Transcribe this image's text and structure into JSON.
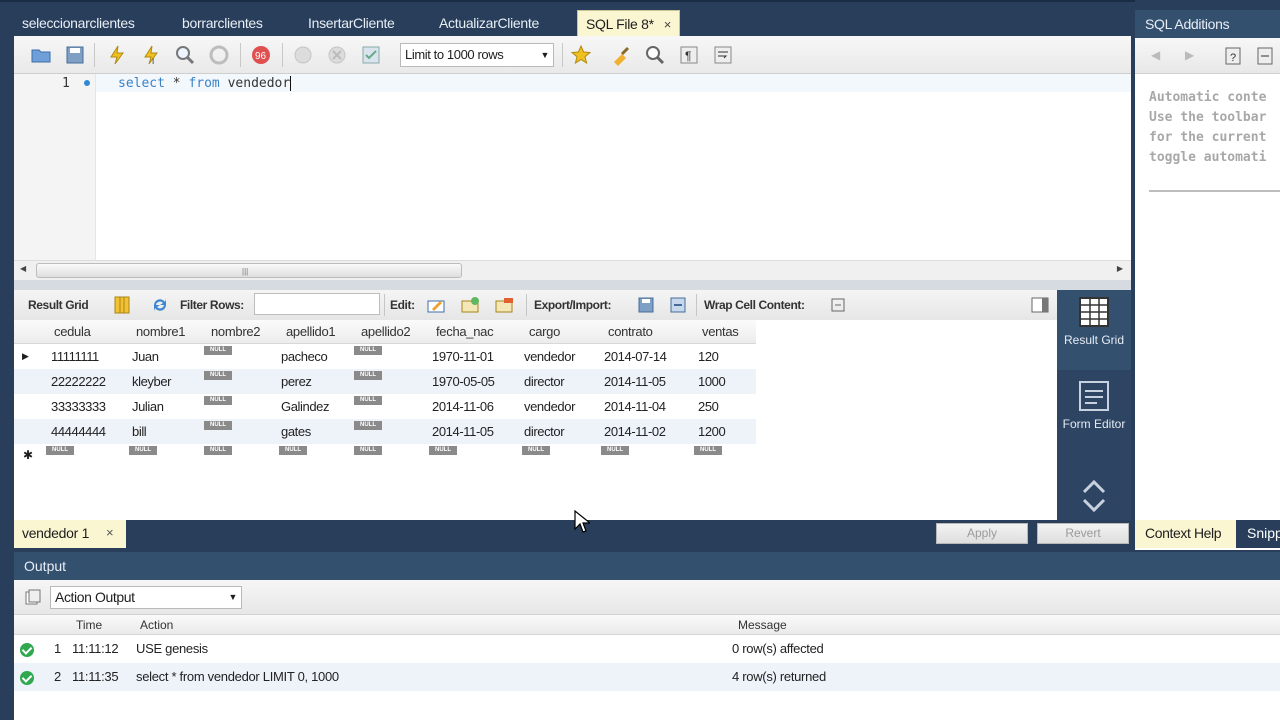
{
  "tabs": [
    {
      "label": "seleccionarclientes"
    },
    {
      "label": "borrarclientes"
    },
    {
      "label": "InsertarCliente"
    },
    {
      "label": "ActualizarCliente"
    },
    {
      "label": "SQL File 8*",
      "close": "×"
    }
  ],
  "toolbar": {
    "limit_select": "Limit to 1000 rows"
  },
  "editor": {
    "line_number": "1",
    "kw_select": "select",
    "star": " * ",
    "kw_from": "from",
    "table": " vendedor"
  },
  "result_toolbar": {
    "result_grid": "Result Grid",
    "filter_rows": "Filter Rows:",
    "edit": "Edit:",
    "export_import": "Export/Import:",
    "wrap_cell": "Wrap Cell Content:"
  },
  "grid": {
    "columns": [
      "cedula",
      "nombre1",
      "nombre2",
      "apellido1",
      "apellido2",
      "fecha_nac",
      "cargo",
      "contrato",
      "ventas"
    ],
    "null_label": "NULL",
    "rows": [
      [
        "11111111",
        "Juan",
        "NULL",
        "pacheco",
        "NULL",
        "1970-11-01",
        "vendedor",
        "2014-07-14",
        "120"
      ],
      [
        "22222222",
        "kleyber",
        "NULL",
        "perez",
        "NULL",
        "1970-05-05",
        "director",
        "2014-11-05",
        "1000"
      ],
      [
        "33333333",
        "Julian",
        "NULL",
        "Galindez",
        "NULL",
        "2014-11-06",
        "vendedor",
        "2014-11-04",
        "250"
      ],
      [
        "44444444",
        "bill",
        "NULL",
        "gates",
        "NULL",
        "2014-11-05",
        "director",
        "2014-11-02",
        "1200"
      ]
    ]
  },
  "side_panel": {
    "result_grid": "Result Grid",
    "form_editor": "Form Editor"
  },
  "result_tabs": {
    "tab_label": "vendedor 1",
    "close": "×",
    "apply": "Apply",
    "revert": "Revert"
  },
  "sql_additions": {
    "title": "SQL Additions",
    "help_text": "Automatic conte\nUse the toolbar\nfor the current \ntoggle automati",
    "context_help": "Context Help",
    "snippets": "Snipp"
  },
  "output": {
    "title": "Output",
    "selector": "Action Output",
    "columns": {
      "time": "Time",
      "action": "Action",
      "message": "Message"
    },
    "rows": [
      {
        "num": "1",
        "time": "11:11:12",
        "action": "USE genesis",
        "message": "0 row(s) affected"
      },
      {
        "num": "2",
        "time": "11:11:35",
        "action": "select * from vendedor LIMIT 0, 1000",
        "message": "4 row(s) returned"
      }
    ]
  },
  "colors": {
    "chrome": "#283e5a",
    "active_tab": "#fbf6d2",
    "keyword": "#3a82c8",
    "ok": "#2fa84f"
  }
}
